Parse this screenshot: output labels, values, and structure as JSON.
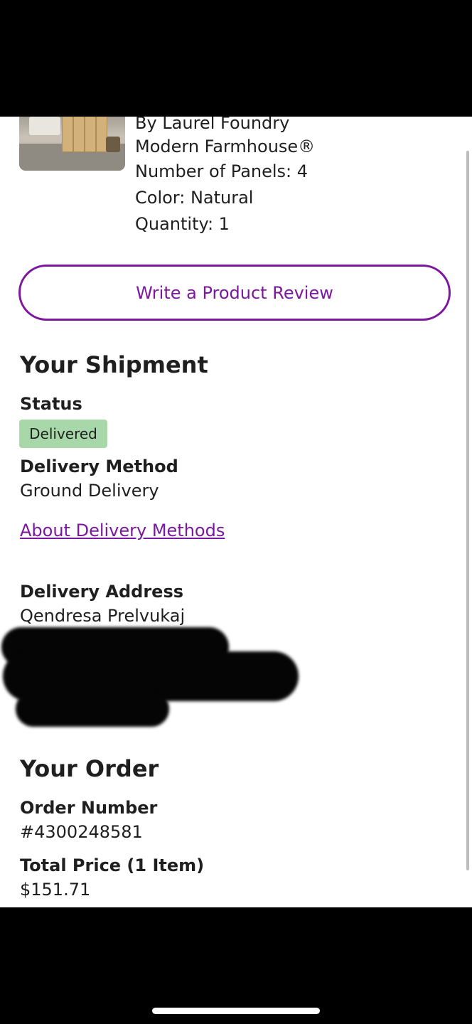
{
  "product": {
    "image_alt": "room-divider-product-image",
    "brand_line1": "By Laurel Foundry",
    "brand_line2": "Modern Farmhouse®",
    "panels": "Number of Panels: 4",
    "color": "Color: Natural",
    "quantity": "Quantity: 1"
  },
  "review_button": {
    "label": "Write a Product Review"
  },
  "shipment": {
    "heading": "Your Shipment",
    "status_label": "Status",
    "status_value": "Delivered",
    "method_label": "Delivery Method",
    "method_value": "Ground Delivery",
    "about_link": "About Delivery Methods",
    "address_label": "Delivery Address",
    "address_name": "Qendresa Prelvukaj"
  },
  "order": {
    "heading": "Your Order",
    "number_label": "Order Number",
    "number_value": "#4300248581",
    "total_label": "Total Price (1 Item)",
    "total_value": "$151.71"
  },
  "colors": {
    "accent": "#7b189f",
    "badge_bg": "#a8d8a9",
    "text": "#1f1f1f"
  }
}
